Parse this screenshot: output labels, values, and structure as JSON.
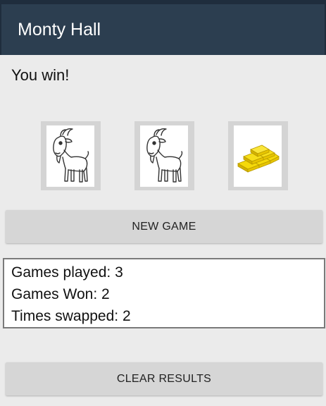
{
  "app": {
    "title": "Monty Hall"
  },
  "game": {
    "message": "You win!",
    "doors": [
      {
        "icon": "goat-icon",
        "prize": "goat"
      },
      {
        "icon": "goat-icon",
        "prize": "goat"
      },
      {
        "icon": "gold-bars-icon",
        "prize": "gold"
      }
    ]
  },
  "buttons": {
    "new_game": "NEW GAME",
    "clear_results": "CLEAR RESULTS"
  },
  "results": {
    "games_played": "Games played: 3",
    "games_won": "Games Won: 2",
    "times_swapped": "Times swapped: 2"
  },
  "colors": {
    "app_bar": "#2c3e50",
    "background": "#ebebeb",
    "button": "#d6d6d6",
    "gold": "#f2d20f"
  }
}
